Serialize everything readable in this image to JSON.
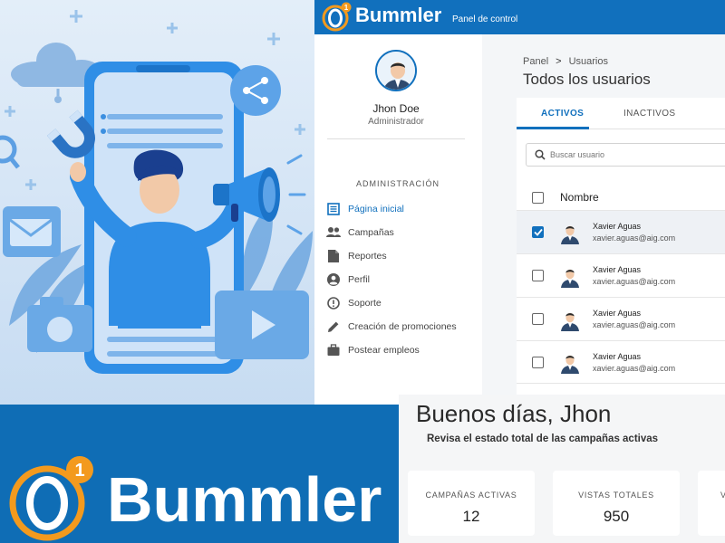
{
  "brand": {
    "name": "Bummler",
    "subtitle": "Panel de control",
    "badge": "1",
    "colors": {
      "primary": "#1170bd",
      "accent": "#f39a1e"
    }
  },
  "sidebar": {
    "user": {
      "name": "Jhon Doe",
      "role": "Administrador"
    },
    "section_title": "ADMINISTRACIÓN",
    "items": [
      {
        "label": "Página inicial",
        "icon": "dashboard-icon",
        "active": true
      },
      {
        "label": "Campañas",
        "icon": "people-icon",
        "active": false
      },
      {
        "label": "Reportes",
        "icon": "document-icon",
        "active": false
      },
      {
        "label": "Perfil",
        "icon": "account-circle-icon",
        "active": false
      },
      {
        "label": "Soporte",
        "icon": "alert-circle-icon",
        "active": false
      },
      {
        "label": "Creación de promociones",
        "icon": "pencil-icon",
        "active": false
      },
      {
        "label": "Postear empleos",
        "icon": "briefcase-icon",
        "active": false
      }
    ]
  },
  "main": {
    "breadcrumb": [
      "Panel",
      "Usuarios"
    ],
    "breadcrumb_separator": ">",
    "title": "Todos los usuarios",
    "tabs": [
      {
        "label": "ACTIVOS",
        "active": true
      },
      {
        "label": "INACTIVOS",
        "active": false
      }
    ],
    "search_placeholder": "Buscar usuario",
    "table": {
      "header": "Nombre",
      "rows": [
        {
          "name": "Xavier Aguas",
          "email": "xavier.aguas@aig.com",
          "checked": true
        },
        {
          "name": "Xavier Aguas",
          "email": "xavier.aguas@aig.com",
          "checked": false
        },
        {
          "name": "Xavier Aguas",
          "email": "xavier.aguas@aig.com",
          "checked": false
        },
        {
          "name": "Xavier Aguas",
          "email": "xavier.aguas@aig.com",
          "checked": false
        }
      ]
    }
  },
  "dashboard": {
    "greeting": "Buenos días, Jhon",
    "subtitle": "Revisa el estado total de las campañas activas",
    "stats": [
      {
        "label": "CAMPAÑAS ACTIVAS",
        "value": "12"
      },
      {
        "label": "VISTAS TOTALES",
        "value": "950"
      },
      {
        "label": "V",
        "value": ""
      }
    ]
  }
}
